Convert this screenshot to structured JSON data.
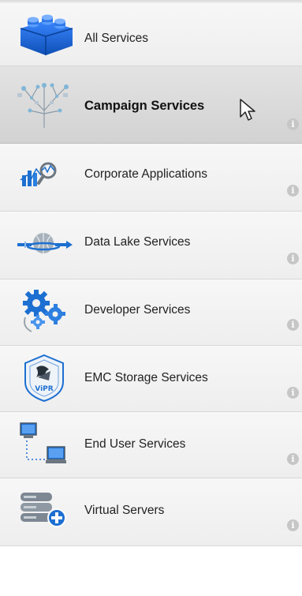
{
  "services": {
    "items": [
      {
        "label": "All Services",
        "icon": "lego-block-icon"
      },
      {
        "label": "Campaign Services",
        "icon": "network-tree-icon",
        "selected": true
      },
      {
        "label": "Corporate Applications",
        "icon": "analytics-magnifier-icon"
      },
      {
        "label": "Data Lake Services",
        "icon": "globe-data-flow-icon"
      },
      {
        "label": "Developer Services",
        "icon": "gears-icon"
      },
      {
        "label": "EMC Storage Services",
        "icon": "vipr-shield-icon"
      },
      {
        "label": "End User Services",
        "icon": "connected-computers-icon"
      },
      {
        "label": "Virtual Servers",
        "icon": "server-add-icon"
      }
    ],
    "info_glyph": "i"
  },
  "colors": {
    "accent_blue": "#1d6fd1",
    "selected_bg": "#d9d9d9",
    "item_bg": "#f3f3f3"
  }
}
